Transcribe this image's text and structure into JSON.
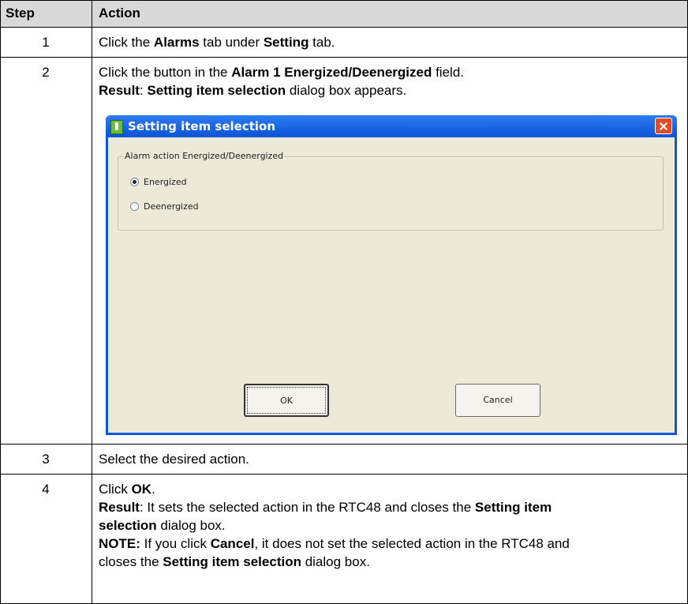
{
  "table": {
    "headers": [
      "Step",
      "Action"
    ],
    "rows": [
      {
        "step": "1",
        "lines": [
          "Click the |Alarms| tab under |Setting| tab."
        ]
      },
      {
        "step": "2",
        "lines": [
          "Click the button in the |Alarm 1 Energized/Deenergized| field.",
          "|Result|: |Setting item selection| dialog box appears."
        ]
      },
      {
        "step": "3",
        "lines": [
          "Select the desired action."
        ]
      },
      {
        "step": "4",
        "lines": [
          "Click |OK|.",
          "|Result|: It sets the selected action in the RTC48 and closes the |Setting item|",
          "|selection| dialog box.",
          "|NOTE:| If you click |Cancel|, it does not set the selected action in the RTC48 and",
          "closes the |Setting item selection| dialog box."
        ]
      }
    ]
  },
  "dialog": {
    "title": "Setting item selection",
    "group_label": "Alarm action Energized/Deenergized",
    "options": [
      {
        "label": "Energized",
        "selected": true
      },
      {
        "label": "Deenergized",
        "selected": false
      }
    ],
    "ok_label": "OK",
    "cancel_label": "Cancel"
  }
}
